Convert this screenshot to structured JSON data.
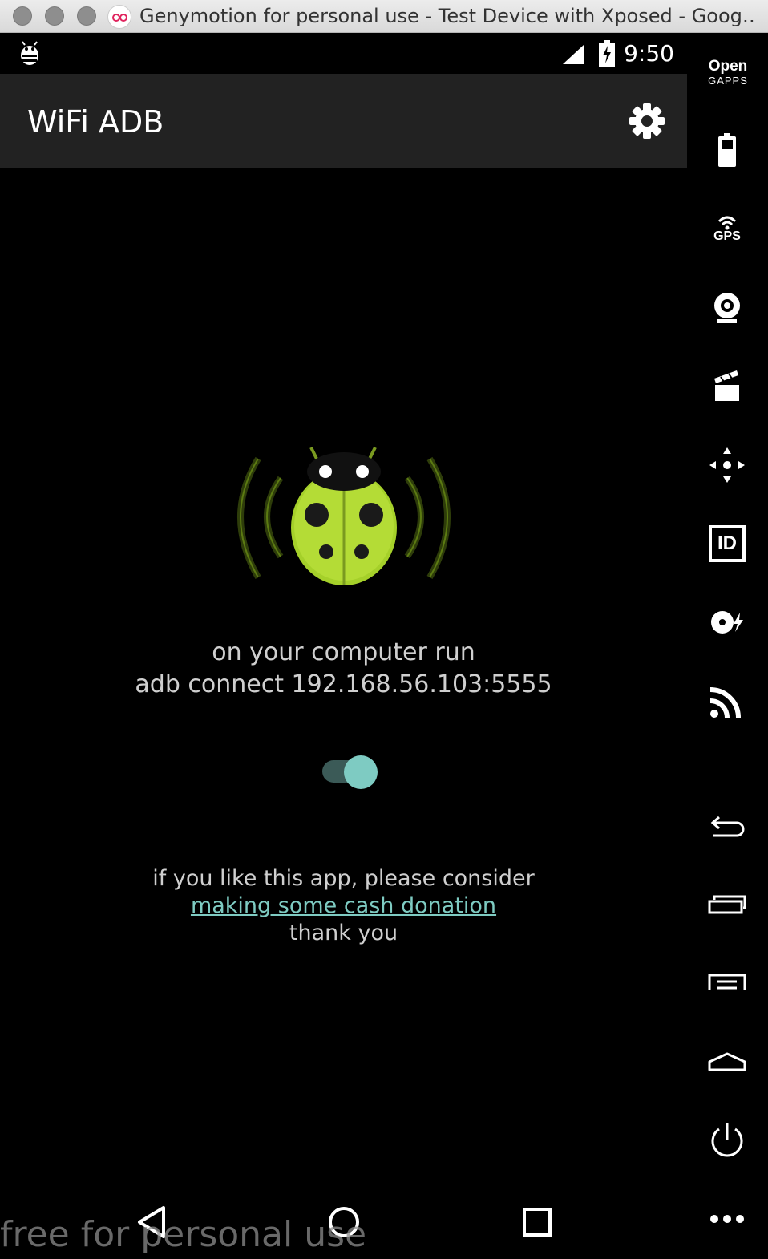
{
  "window": {
    "title": "Genymotion for personal use - Test Device with Xposed - Goog…",
    "buttons": [
      "close",
      "minimize",
      "zoom"
    ]
  },
  "status_bar": {
    "time": "9:50",
    "icons": [
      "bug-notification-icon",
      "signal-icon",
      "battery-charging-icon"
    ]
  },
  "app_bar": {
    "title": "WiFi ADB",
    "settings_icon": "gear-icon"
  },
  "main": {
    "instruction_line1": "on your computer run",
    "instruction_line2": "adb connect 192.168.56.103:5555",
    "toggle_on": true,
    "donate_line1": "if you like this app, please consider",
    "donate_link": "making some cash donation",
    "donate_line3": "thank you"
  },
  "nav_bar": {
    "buttons": [
      "back-icon",
      "home-icon",
      "recents-icon"
    ]
  },
  "watermark": "free for personal use",
  "sidebar": {
    "open_gapps_line1": "Open",
    "open_gapps_line2": "GAPPS",
    "gps_label": "GPS",
    "id_label": "ID",
    "items": [
      "battery",
      "gps",
      "webcam",
      "capture",
      "remote-control",
      "identifiers",
      "disk-io",
      "network",
      "back",
      "recent-apps",
      "menu",
      "home",
      "power",
      "more"
    ]
  },
  "colors": {
    "accent": "#7ecbc2",
    "app_bar": "#222222",
    "bug_green": "#a5d02a"
  }
}
